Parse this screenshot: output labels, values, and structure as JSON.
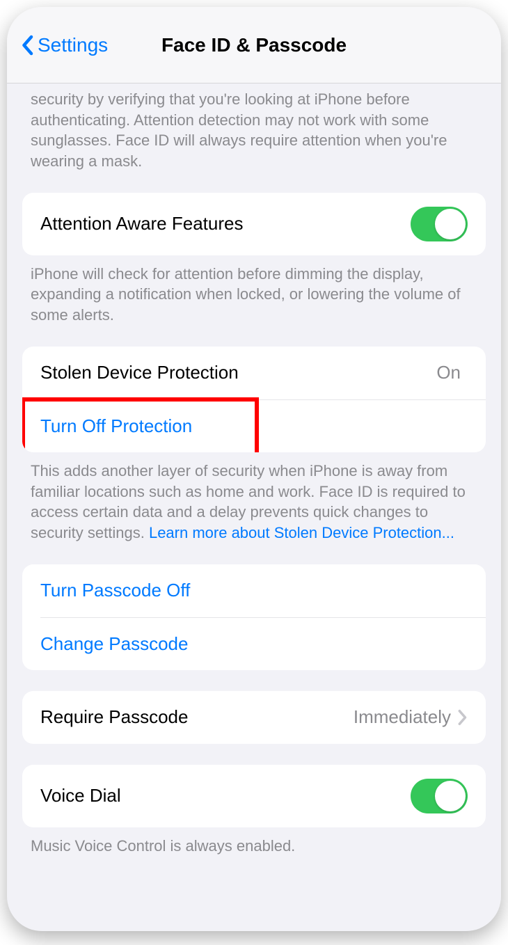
{
  "nav": {
    "back_label": "Settings",
    "title": "Face ID & Passcode"
  },
  "attention_desc": "security by verifying that you're looking at iPhone before authenticating. Attention detection may not work with some sunglasses. Face ID will always require attention when you're wearing a mask.",
  "attention_aware": {
    "label": "Attention Aware Features",
    "footer": "iPhone will check for attention before dimming the display, expanding a notification when locked, or lowering the volume of some alerts."
  },
  "stolen_device": {
    "label": "Stolen Device Protection",
    "value": "On",
    "turn_off_label": "Turn Off Protection",
    "footer_text": "This adds another layer of security when iPhone is away from familiar locations such as home and work. Face ID is required to access certain data and a delay prevents quick changes to security settings. ",
    "footer_link": "Learn more about Stolen Device Protection..."
  },
  "passcode": {
    "turn_off_label": "Turn Passcode Off",
    "change_label": "Change Passcode"
  },
  "require_passcode": {
    "label": "Require Passcode",
    "value": "Immediately"
  },
  "voice_dial": {
    "label": "Voice Dial",
    "footer": "Music Voice Control is always enabled."
  }
}
